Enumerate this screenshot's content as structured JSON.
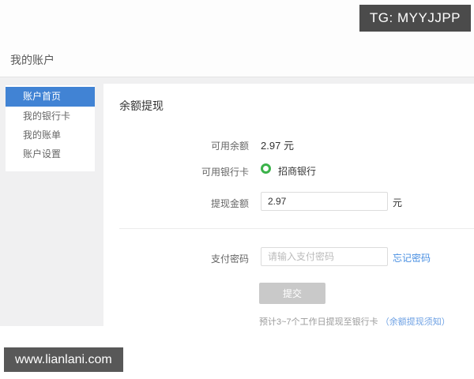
{
  "badges": {
    "tg": "TG: MYYJJPP",
    "watermark": "www.lianlani.com"
  },
  "header": {
    "title": "我的账户"
  },
  "sidebar": {
    "items": [
      {
        "label": "账户首页",
        "active": true
      },
      {
        "label": "我的银行卡",
        "active": false
      },
      {
        "label": "我的账单",
        "active": false
      },
      {
        "label": "账户设置",
        "active": false
      }
    ]
  },
  "main": {
    "title": "余额提现",
    "balance": {
      "label": "可用余额",
      "value": "2.97",
      "unit": "元"
    },
    "bank_card": {
      "label": "可用银行卡",
      "selected_bank": "招商银行",
      "radio_state": "selected"
    },
    "amount": {
      "label": "提现金额",
      "value": "2.97",
      "unit": "元"
    },
    "password": {
      "label": "支付密码",
      "value": "",
      "placeholder": "请输入支付密码",
      "forgot_link": "忘记密码"
    },
    "submit_label": "提交",
    "note": {
      "text": "预计3~7个工作日提现至银行卡 ",
      "link": "（余额提现须知）"
    }
  },
  "colors": {
    "accent_blue": "#4183d4",
    "link_blue": "#4a90e2",
    "radio_green": "#3bb24a",
    "disabled_button": "#c9c9c9",
    "page_background": "#f0f0f1",
    "badge_dark": "#4b4b4b"
  }
}
